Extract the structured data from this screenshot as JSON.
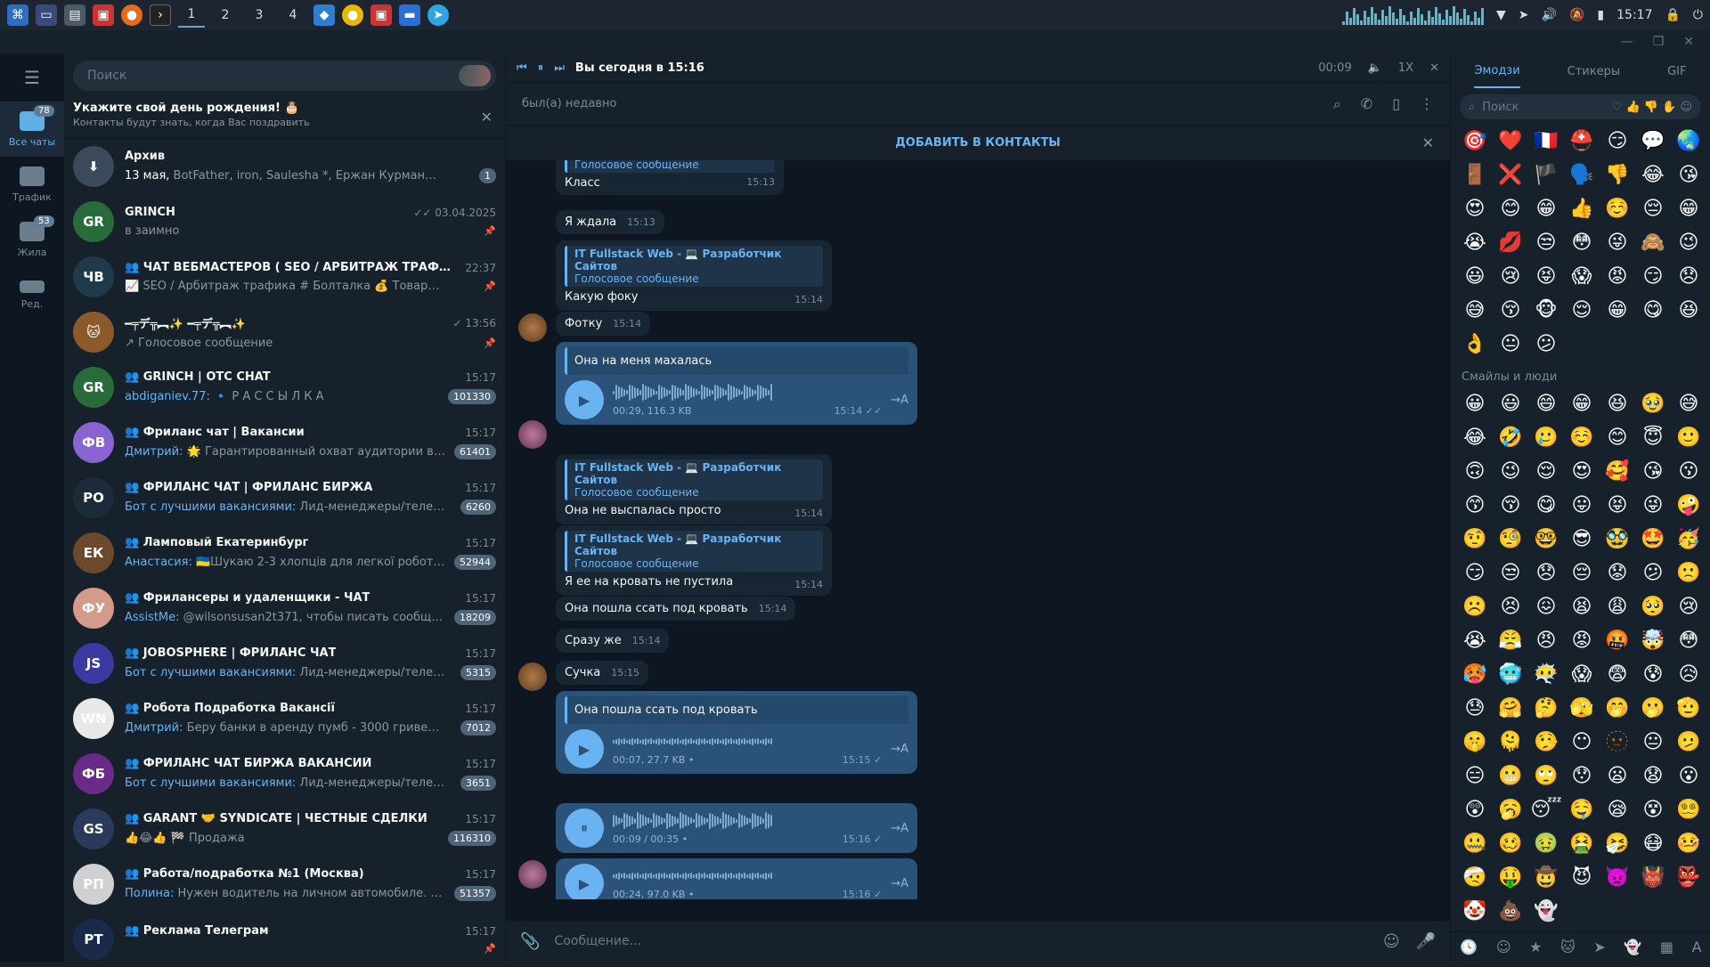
{
  "taskbar": {
    "workspaces": [
      "1",
      "2",
      "3",
      "4"
    ],
    "clock": "15:17"
  },
  "rail": {
    "items": [
      {
        "label": "Все чаты",
        "badge": "78"
      },
      {
        "label": "Трафик",
        "badge": ""
      },
      {
        "label": "Жила",
        "badge": "53"
      },
      {
        "label": "Ред.",
        "badge": ""
      }
    ]
  },
  "chatlist": {
    "search_placeholder": "Поиск",
    "birthday_title": "Укажите свой день рождения! 🎂",
    "birthday_sub": "Контакты будут знать, когда Вас поздравить",
    "archive": {
      "name": "Архив",
      "date": "13 мая,",
      "preview": "BotFather, iron, Saulesha *, Ержан Курманжан, Elnur S...",
      "badge": "1"
    },
    "rows": [
      {
        "name": "GRINCH",
        "time": "✓✓ 03.04.2025",
        "sender": "",
        "preview": "в заимно",
        "badge": "",
        "avatar": "#2a6b3a",
        "initials": "GR"
      },
      {
        "name": "👥 ЧАТ ВЕБМАСТЕРОВ ( SEO / АРБИТРАЖ ТРАФИКА / АФФ...",
        "time": "22:37",
        "sender": "",
        "preview": "📈 SEO / Арбитраж трафика  # Болталка  💰 Товары  ‼️ П...",
        "badge": "",
        "avatar": "#1f3a4a",
        "initials": "ЧВ"
      },
      {
        "name": "━╤デ╦︻✨ ━╤デ╦︻✨",
        "time": "✓ 13:56",
        "sender": "",
        "preview": "↗ Голосовое сообщение",
        "badge": "",
        "avatar": "#8a5a2a",
        "initials": "🐱"
      },
      {
        "name": "👥 GRINCH | OTC CHAT",
        "time": "15:17",
        "sender": "abdiganiev.77:",
        "preview": " 🔹 Р А С С Ы Л К А",
        "badge": "101330",
        "avatar": "#2a6b3a",
        "initials": "GR"
      },
      {
        "name": "👥 Фриланс чат | Вакансии",
        "time": "15:17",
        "sender": "Дмитрий:",
        "preview": " 🌟 Гарантированный охват аудитории в ...",
        "badge": "61401",
        "avatar": "#8a63d2",
        "initials": "ФВ"
      },
      {
        "name": "👥 ФРИЛАНС ЧАТ | ФРИЛАНС БИРЖА",
        "time": "15:17",
        "sender": "Бот с лучшими вакансиями:",
        "preview": " Лид-менеджеры/телемаркет...",
        "badge": "6260",
        "avatar": "#1c2b3a",
        "initials": "РО"
      },
      {
        "name": "👥 Ламповый Екатеринбург",
        "time": "15:17",
        "sender": "Анастасия:",
        "preview": " 🇺🇦Шукаю 2-3 хлопців для легкої роботи...",
        "badge": "52944",
        "avatar": "#6a4a2a",
        "initials": "ЕК"
      },
      {
        "name": "👥 Фрилансеры и удаленщики - ЧАТ",
        "time": "15:17",
        "sender": "AssistMe:",
        "preview": " @wilsonsusan2t371, чтобы писать сообщения ...",
        "badge": "18209",
        "avatar": "#d49a8a",
        "initials": "ФУ"
      },
      {
        "name": "👥 JOBOSPHERE | ФРИЛАНС ЧАТ",
        "time": "15:17",
        "sender": "Бот с лучшими вакансиями:",
        "preview": " Лид-менеджеры/телемаркет...",
        "badge": "5315",
        "avatar": "#3a3aa0",
        "initials": "JS"
      },
      {
        "name": "👥 Робота Подработка Вакансії",
        "time": "15:17",
        "sender": "Дмитрий:",
        "preview": " Беру банки в аренду  пумб - 3000 гривен  МОН...",
        "badge": "7012",
        "avatar": "#e8e8e8",
        "initials": "WN"
      },
      {
        "name": "👥 ФРИЛАНС ЧАТ БИРЖА ВАКАНСИЙ",
        "time": "15:17",
        "sender": "Бот с лучшими вакансиями:",
        "preview": " Лид-менеджеры/телемаркет...",
        "badge": "3651",
        "avatar": "#6a2a8a",
        "initials": "ФБ"
      },
      {
        "name": "👥 GARANT 🤝 SYNDICATE | ЧЕСТНЫЕ СДЕЛКИ",
        "time": "15:17",
        "sender": "",
        "preview": "👍😂👍 🏁 Продажа",
        "badge": "116310",
        "avatar": "#2a3a5a",
        "initials": "GS"
      },
      {
        "name": "👥 Работа/подработка №1 (Москва)",
        "time": "15:17",
        "sender": "Полина:",
        "preview": " Нужен водитель на личном автомобиле. 150 00...",
        "badge": "51357",
        "avatar": "#d0d0d0",
        "initials": "РП"
      },
      {
        "name": "👥 Реклама Телеграм",
        "time": "15:17",
        "sender": "",
        "preview": "",
        "badge": "",
        "avatar": "#1a2a4a",
        "initials": "РТ"
      }
    ]
  },
  "player": {
    "title": "Вы сегодня в 15:16",
    "time": "00:09",
    "speed": "1X"
  },
  "header": {
    "status": "был(а) недавно",
    "add_contact": "ДОБАВИТЬ В КОНТАКТЫ"
  },
  "messages": {
    "m1": {
      "reply_sub": "Голосовое сообщение",
      "text": "Класс",
      "time": "15:13"
    },
    "m2": {
      "text": "Я ждала",
      "time": "15:13"
    },
    "m3": {
      "reply_name": "IT Fullstack Web - 💻 Разработчик Сайтов",
      "reply_sub": "Голосовое сообщение",
      "text": "Какую фоку",
      "time": "15:14"
    },
    "m4": {
      "text": "Фотку",
      "time": "15:14"
    },
    "v1": {
      "caption": "Она на меня махалась",
      "meta": "00:29, 116.3 KB",
      "time": "15:14 ✓✓"
    },
    "m5": {
      "reply_name": "IT Fullstack Web - 💻 Разработчик Сайтов",
      "reply_sub": "Голосовое сообщение",
      "text": "Она не выспалась просто",
      "time": "15:14"
    },
    "m6": {
      "reply_name": "IT Fullstack Web - 💻 Разработчик Сайтов",
      "reply_sub": "Голосовое сообщение",
      "text": "Я ее на кровать не пустила",
      "time": "15:14"
    },
    "m7": {
      "text": "Она пошла ссать под кровать",
      "time": "15:14"
    },
    "m8": {
      "text": "Сразу же",
      "time": "15:14"
    },
    "m9": {
      "text": "Сучка",
      "time": "15:15"
    },
    "v2": {
      "caption": "Она пошла ссать под кровать",
      "meta": "00:07, 27.7 KB  •",
      "time": "15:15 ✓"
    },
    "v3": {
      "meta": "00:09 / 00:35  •",
      "time": "15:16 ✓"
    },
    "v4": {
      "meta": "00:24, 97.0 KB  •",
      "time": "15:16 ✓"
    }
  },
  "composer": {
    "placeholder": "Сообщение..."
  },
  "emoji": {
    "tabs": [
      "Эмодзи",
      "Стикеры",
      "GIF"
    ],
    "search_placeholder": "Поиск",
    "section": "Смайлы и люди",
    "recent": "🎯❤️🇫🇷⛑️😏💬🌏🚪❌🏴󠁧󠁢󠁥󠁮󠁧󠁿🗣️👎😂😘😍😊😁👍☺️😔😁😭💋😒😳😜🙈😉😃😢😝😱😡😏😞😅😚🐵😌😁😋😆👌😐😕",
    "people": "😀😃😄😁😆🥹😅😂🤣🥲☺️😊😇🙂🙃😉😌😍🥰😘😗😙😚😋😛😝😜🤪🤨🧐🤓😎🥸🤩🥳😏😒😞😔😟😕🙁☹️😣😖😫😩🥺😢😭😤😠😡🤬🤯😳🥵🥶😶‍🌫️😱😨😰😥😓🤗🤔🫣🤭🫢🫡🤫🫠🤥😶🫥😐🫤😑😬🙄😯😦😧😮😲🥱😴🤤😪😵😵‍💫🤐🥴🤢🤮🤧😷🤒🤕🤑🤠😈👿👹👺🤡💩👻"
  }
}
